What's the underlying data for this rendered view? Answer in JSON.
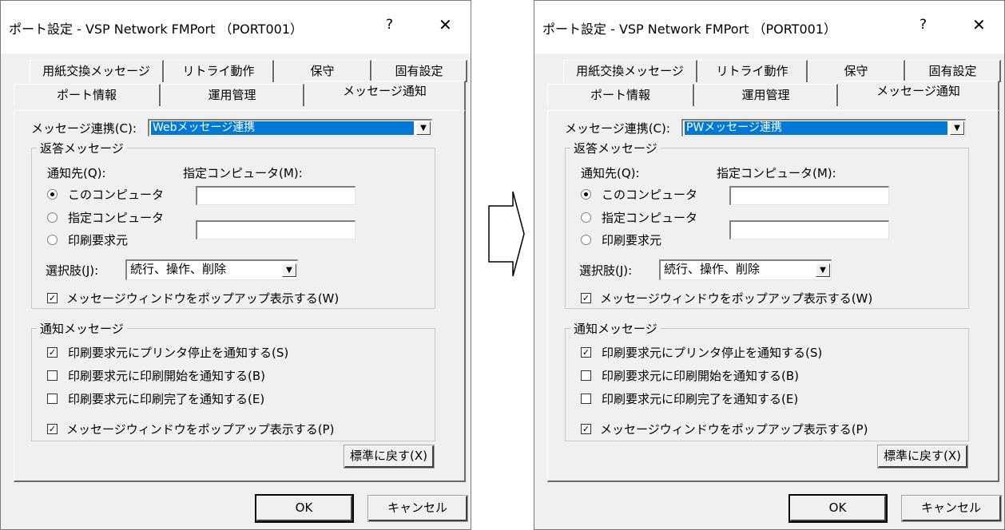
{
  "dialogs": [
    {
      "title": "ポート設定 - VSP Network FMPort （PORT001）",
      "help": "?",
      "close": "✕",
      "tabs_row1": [
        "用紙交換メッセージ",
        "リトライ動作",
        "保守",
        "固有設定"
      ],
      "tabs_row2": [
        "ポート情報",
        "運用管理",
        "メッセージ通知"
      ],
      "link_label": "メッセージ連携(C):",
      "link_value": "Webメッセージ連携",
      "reply_group": "返答メッセージ",
      "notify_to": "通知先(Q):",
      "specified_pc": "指定コンピュータ(M):",
      "radio_this": "このコンピュータ",
      "radio_specified": "指定コンピュータ",
      "radio_origin": "印刷要求元",
      "choice_label": "選択肢(J):",
      "choice_value": "続行、操作、削除",
      "reply_popup": "メッセージウィンドウをポップアップ表示する(W)",
      "notify_group": "通知メッセージ",
      "notify_stop": "印刷要求元にプリンタ停止を通知する(S)",
      "notify_start": "印刷要求元に印刷開始を通知する(B)",
      "notify_done": "印刷要求元に印刷完了を通知する(E)",
      "notify_popup": "メッセージウィンドウをポップアップ表示する(P)",
      "reset": "標準に戻す(X)",
      "ok": "OK",
      "cancel": "キャンセル"
    },
    {
      "title": "ポート設定 - VSP Network FMPort （PORT001）",
      "help": "?",
      "close": "✕",
      "tabs_row1": [
        "用紙交換メッセージ",
        "リトライ動作",
        "保守",
        "固有設定"
      ],
      "tabs_row2": [
        "ポート情報",
        "運用管理",
        "メッセージ通知"
      ],
      "link_label": "メッセージ連携(C):",
      "link_value": "PWメッセージ連携",
      "reply_group": "返答メッセージ",
      "notify_to": "通知先(Q):",
      "specified_pc": "指定コンピュータ(M):",
      "radio_this": "このコンピュータ",
      "radio_specified": "指定コンピュータ",
      "radio_origin": "印刷要求元",
      "choice_label": "選択肢(J):",
      "choice_value": "続行、操作、削除",
      "reply_popup": "メッセージウィンドウをポップアップ表示する(W)",
      "notify_group": "通知メッセージ",
      "notify_stop": "印刷要求元にプリンタ停止を通知する(S)",
      "notify_start": "印刷要求元に印刷開始を通知する(B)",
      "notify_done": "印刷要求元に印刷完了を通知する(E)",
      "notify_popup": "メッセージウィンドウをポップアップ表示する(P)",
      "reset": "標準に戻す(X)",
      "ok": "OK",
      "cancel": "キャンセル"
    }
  ],
  "state": {
    "radio_selected": "このコンピュータ",
    "reply_popup_checked": true,
    "notify_stop_checked": true,
    "notify_start_checked": false,
    "notify_done_checked": false,
    "notify_popup_checked": true
  },
  "icons": {
    "transition": "right-arrow-icon"
  }
}
